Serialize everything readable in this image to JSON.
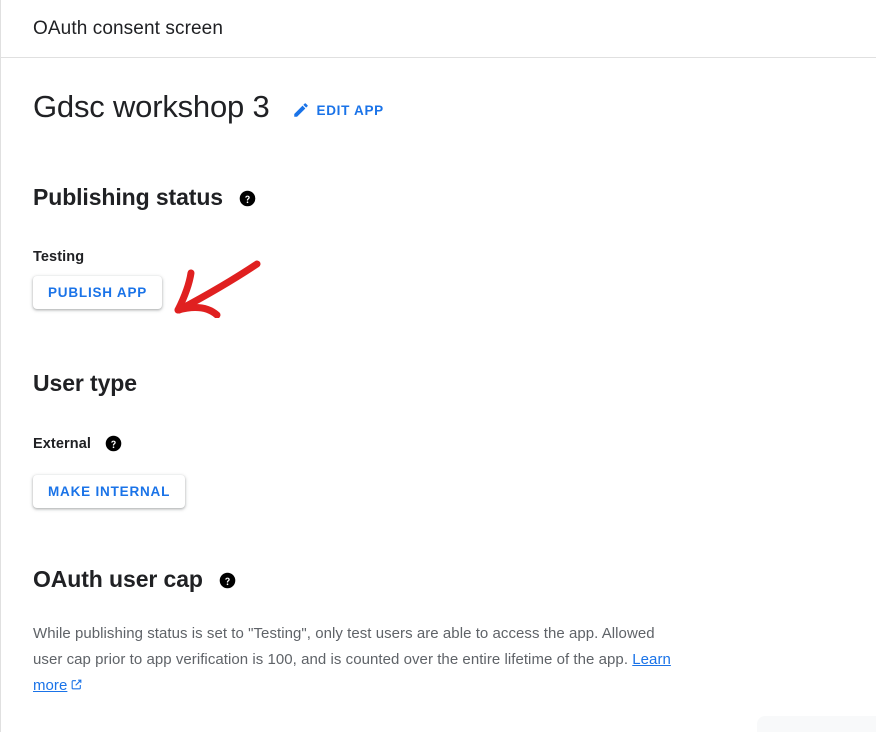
{
  "header": {
    "title": "OAuth consent screen"
  },
  "app": {
    "name": "Gdsc workshop 3",
    "edit_label": "EDIT APP",
    "edit_icon": "pencil-icon"
  },
  "sections": {
    "publishing": {
      "heading": "Publishing status",
      "help_icon": "help-circle-icon",
      "value": "Testing",
      "button_label": "PUBLISH APP"
    },
    "user_type": {
      "heading": "User type",
      "help_icon": "help-circle-icon",
      "value": "External",
      "button_label": "MAKE INTERNAL"
    },
    "user_cap": {
      "heading": "OAuth user cap",
      "help_icon": "help-circle-icon",
      "description_part1": "While publishing status is set to \"Testing\", only test users are able to access the app. Allowed user cap prior to app verification is 100, and is counted over the entire lifetime of the app. ",
      "learn_more_label": "Learn more",
      "external_link_icon": "external-link-icon"
    }
  },
  "annotation": {
    "type": "arrow",
    "color": "#e02020",
    "points_to": "PUBLISH APP"
  },
  "colors": {
    "accent_blue": "#1a73e8",
    "text_primary": "#202124",
    "text_secondary": "#5f6368",
    "divider": "#e0e0e0",
    "annotation_red": "#e02020"
  }
}
